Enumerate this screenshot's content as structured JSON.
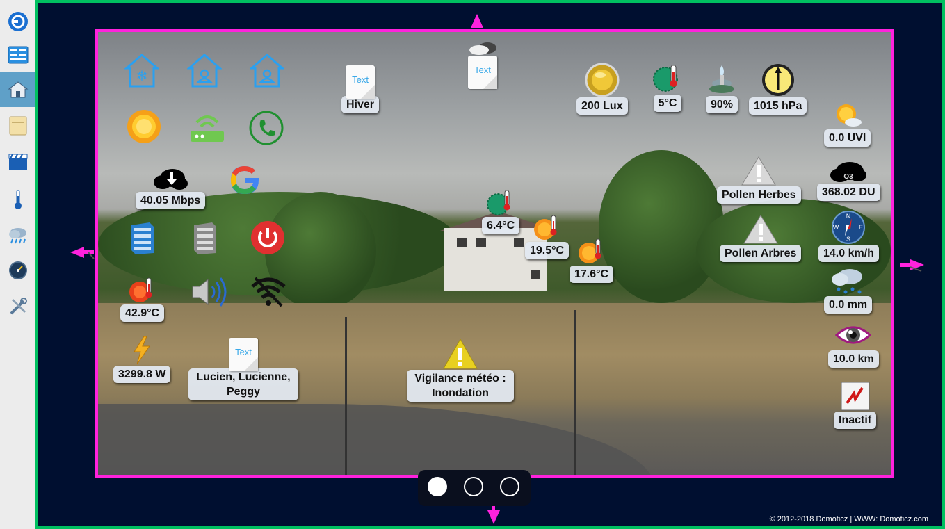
{
  "app": {
    "title": "Domoticz"
  },
  "sidebar": {
    "items": [
      {
        "name": "logo",
        "icon": "domoticz-logo-icon"
      },
      {
        "name": "dashboard",
        "icon": "dashboard-icon"
      },
      {
        "name": "floorplans",
        "icon": "house-icon",
        "active": true
      },
      {
        "name": "switches",
        "icon": "switch-panel-icon"
      },
      {
        "name": "scenes",
        "icon": "clapperboard-icon"
      },
      {
        "name": "temperature",
        "icon": "thermometer-icon"
      },
      {
        "name": "weather",
        "icon": "rain-cloud-icon"
      },
      {
        "name": "utility",
        "icon": "gauge-icon"
      },
      {
        "name": "setup",
        "icon": "tools-icon"
      }
    ]
  },
  "colors": {
    "frame": "#00c060",
    "plan_border": "#ff22dd",
    "background": "#000f30",
    "sidebar_active": "#5fa0c8"
  },
  "devices": {
    "season_text": "Hiver",
    "lux": "200 Lux",
    "temp_outdoor": "5°C",
    "humidity": "90%",
    "pressure": "1015 hPa",
    "uvi": "0.0 UVI",
    "ozone": "368.02 DU",
    "ozone_badge": "O3",
    "pollen_herbes": "Pollen Herbes",
    "pollen_arbres": "Pollen Arbres",
    "wind": "14.0 km/h",
    "rain": "0.0 mm",
    "visibility": "10.0 km",
    "alarm_status": "Inactif",
    "bandwidth": "40.05 Mbps",
    "temp_1": "6.4°C",
    "temp_2": "19.5°C",
    "temp_3": "17.6°C",
    "temp_cpu": "42.9°C",
    "power": "3299.8 W",
    "presence_text": "Lucien, Lucienne, Peggy",
    "vigilance": "Vigilance météo : Inondation",
    "doc_icon_text": "Text"
  },
  "pager": {
    "pages": 3,
    "current": 1
  },
  "footer": {
    "copyright": "© 2012-2018 Domoticz | WWW: Domoticz.com"
  }
}
